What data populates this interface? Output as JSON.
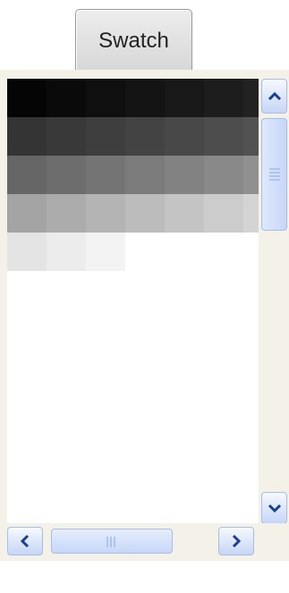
{
  "tab": {
    "label": "Swatch"
  },
  "swatches": {
    "colors": [
      "#050505",
      "#0a0a0a",
      "#0f0f0f",
      "#141414",
      "#181818",
      "#1d1d1d",
      "#222222",
      "#343434",
      "#393939",
      "#3e3e3e",
      "#434343",
      "#484848",
      "#4d4d4d",
      "#525252",
      "#666666",
      "#6d6d6d",
      "#747474",
      "#7b7b7b",
      "#828282",
      "#898989",
      "#909090",
      "#a4a4a4",
      "#acacac",
      "#b4b4b4",
      "#bcbcbc",
      "#c4c4c4",
      "#cccccc",
      "#d4d4d4",
      "#e4e4e4",
      "#ececec",
      "#f3f3f3"
    ]
  },
  "scrollbars": {
    "up_icon": "chevron-up-icon",
    "down_icon": "chevron-down-icon",
    "left_icon": "chevron-left-icon",
    "right_icon": "chevron-right-icon"
  }
}
